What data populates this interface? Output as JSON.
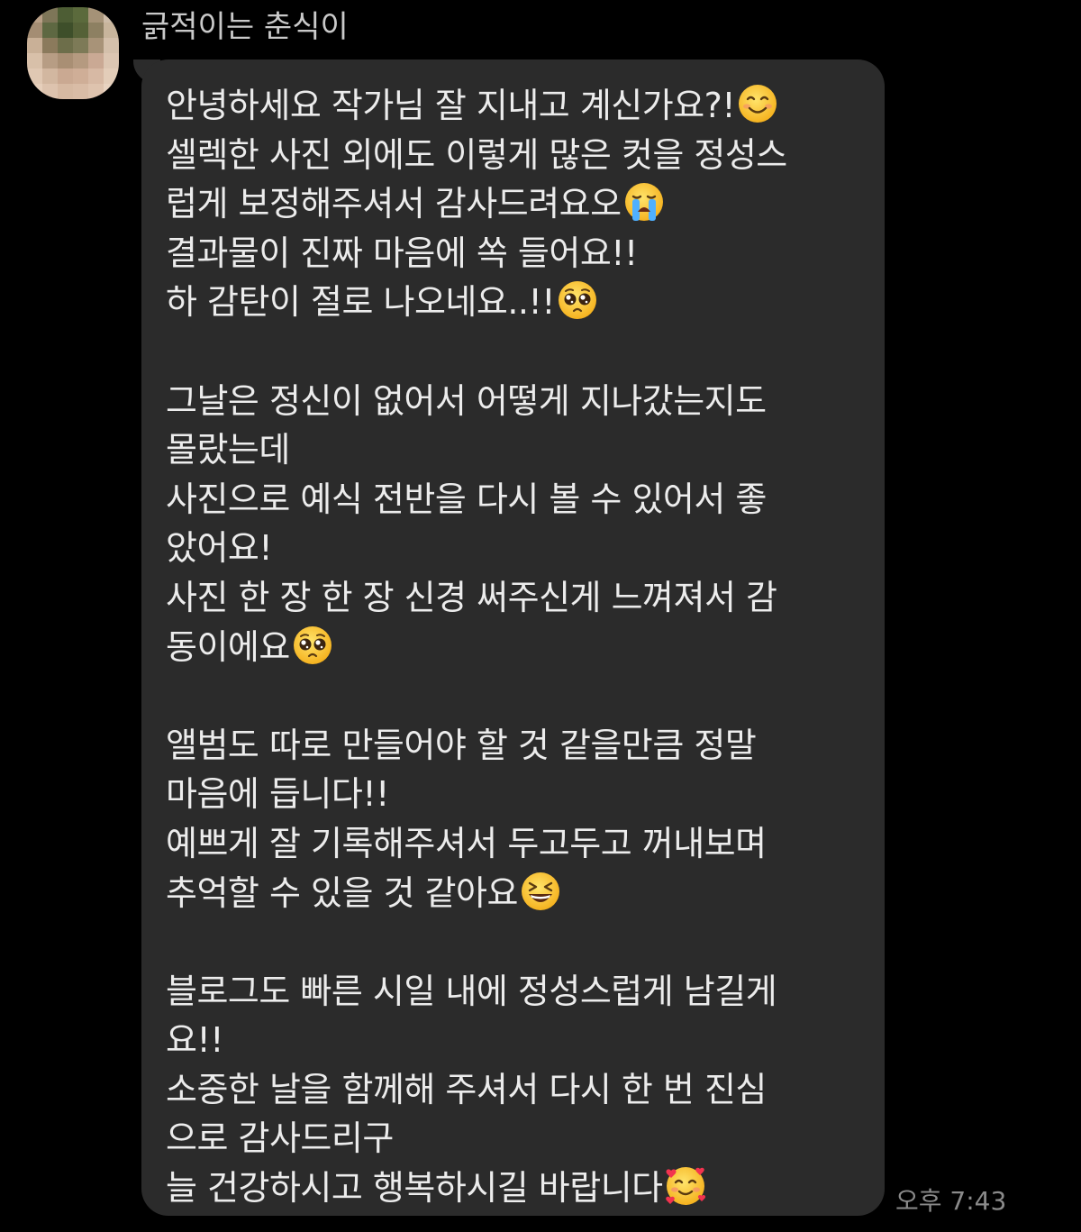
{
  "chat": {
    "sender_name": "긁적이는 춘식이",
    "timestamp": "오후 7:43"
  },
  "message": {
    "lines": [
      {
        "text": "안녕하세요 작가님 잘 지내고 계신가요?!",
        "emoji": "smiling-face"
      },
      {
        "text": "셀렉한 사진 외에도 이렇게 많은 컷을 정성스",
        "emoji": null
      },
      {
        "text": "럽게 보정해주셔서 감사드려요오",
        "emoji": "loudly-crying-face"
      },
      {
        "text": "결과물이 진짜 마음에 쏙 들어요!!",
        "emoji": null
      },
      {
        "text": "하 감탄이 절로 나오네요..!!",
        "emoji": "pleading-face"
      },
      {
        "text": "",
        "emoji": null
      },
      {
        "text": "그날은 정신이 없어서 어떻게 지나갔는지도",
        "emoji": null
      },
      {
        "text": "몰랐는데",
        "emoji": null
      },
      {
        "text": "사진으로 예식 전반을 다시 볼 수 있어서 좋",
        "emoji": null
      },
      {
        "text": "았어요!",
        "emoji": null
      },
      {
        "text": "사진 한 장 한 장 신경 써주신게 느껴져서 감",
        "emoji": null
      },
      {
        "text": "동이에요",
        "emoji": "pleading-face"
      },
      {
        "text": "",
        "emoji": null
      },
      {
        "text": "앨범도 따로 만들어야 할 것 같을만큼 정말",
        "emoji": null
      },
      {
        "text": "마음에 듭니다!!",
        "emoji": null
      },
      {
        "text": "예쁘게 잘 기록해주셔서 두고두고 꺼내보며",
        "emoji": null
      },
      {
        "text": "추억할 수 있을 것 같아요",
        "emoji": "grinning-squinting-face"
      },
      {
        "text": "",
        "emoji": null
      },
      {
        "text": "블로그도 빠른 시일 내에 정성스럽게 남길게",
        "emoji": null
      },
      {
        "text": "요!!",
        "emoji": null
      },
      {
        "text": "소중한 날을 함께해 주셔서 다시 한 번 진심",
        "emoji": null
      },
      {
        "text": "으로 감사드리구",
        "emoji": null
      },
      {
        "text": "늘 건강하시고 행복하시길 바랍니다",
        "emoji": "smiling-face-with-hearts"
      }
    ]
  },
  "colors": {
    "background": "#000000",
    "bubble": "#2b2b2b",
    "message_text": "#ececec",
    "sender_text": "#c9c9c9",
    "timestamp_text": "#8a8a8a"
  }
}
